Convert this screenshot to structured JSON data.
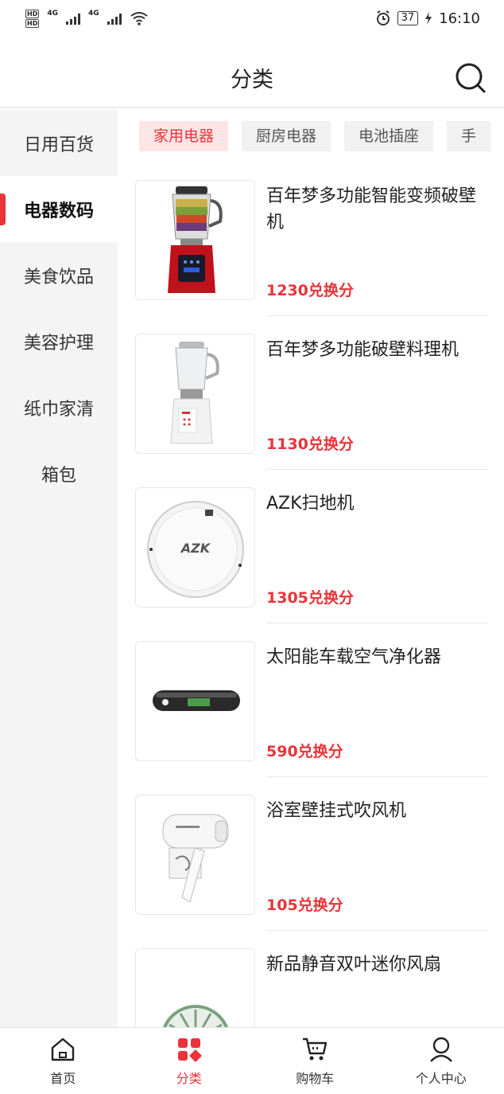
{
  "status_bar": {
    "hd1": "HD",
    "hd2": "HD",
    "net1": "4G",
    "net2": "4G",
    "battery": "37",
    "time": "16:10"
  },
  "header": {
    "title": "分类",
    "search_icon": "search-icon"
  },
  "sidebar": {
    "items": [
      {
        "label": "日用百货"
      },
      {
        "label": "电器数码"
      },
      {
        "label": "美食饮品"
      },
      {
        "label": "美容护理"
      },
      {
        "label": "纸巾家清"
      },
      {
        "label": "箱包"
      }
    ],
    "active_index": 1
  },
  "tabs": [
    {
      "label": "家用电器"
    },
    {
      "label": "厨房电器"
    },
    {
      "label": "电池插座"
    },
    {
      "label": "手"
    }
  ],
  "products": [
    {
      "name": "百年梦多功能智能变频破壁机",
      "price": "1230兑换分"
    },
    {
      "name": "百年梦多功能破壁料理机",
      "price": "1130兑换分"
    },
    {
      "name": "AZK扫地机",
      "price": "1305兑换分"
    },
    {
      "name": "太阳能车载空气净化器",
      "price": "590兑换分"
    },
    {
      "name": "浴室壁挂式吹风机",
      "price": "105兑换分"
    },
    {
      "name": "新品静音双叶迷你风扇",
      "price": ""
    }
  ],
  "product_images": {
    "robot_logo": "AZK"
  },
  "bottom_nav": {
    "items": [
      {
        "label": "首页",
        "icon": "home-icon"
      },
      {
        "label": "分类",
        "icon": "category-icon"
      },
      {
        "label": "购物车",
        "icon": "cart-icon"
      },
      {
        "label": "个人中心",
        "icon": "profile-icon"
      }
    ]
  },
  "colors": {
    "accent": "#e8343a",
    "accent_bg": "#fde5e5",
    "sidebar_bg": "#f4f4f4"
  }
}
